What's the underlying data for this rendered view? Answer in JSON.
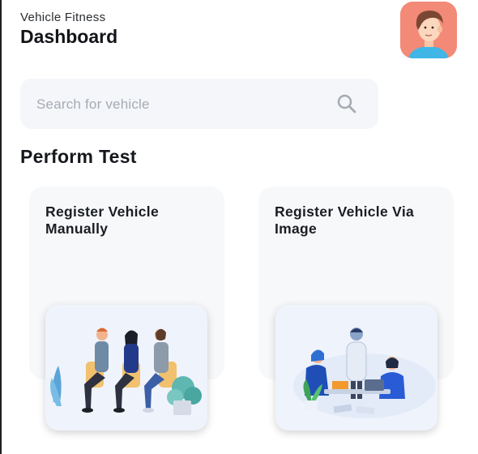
{
  "header": {
    "subtitle": "Vehicle Fitness",
    "title": "Dashboard",
    "avatar_icon": "user-avatar-icon"
  },
  "search": {
    "placeholder": "Search for vehicle",
    "icon": "search-icon"
  },
  "section": {
    "title": "Perform Test"
  },
  "cards": [
    {
      "label": "Register Vehicle\nManually",
      "illustration": "people-waiting-illustration"
    },
    {
      "label": "Register Vehicle Via\nImage",
      "illustration": "team-meeting-illustration"
    }
  ],
  "colors": {
    "accent": "#2a5bd7",
    "avatar_bg": "#f38a77",
    "search_bg": "#f4f6f9",
    "card_bg": "#f7f8fa"
  }
}
